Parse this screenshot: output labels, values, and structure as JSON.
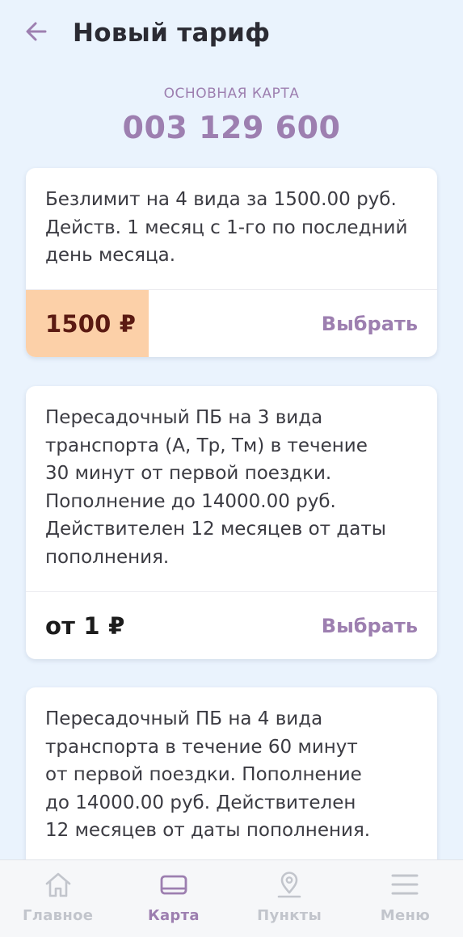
{
  "header": {
    "back_icon": "arrow-left-icon",
    "title": "Новый тариф"
  },
  "card": {
    "label": "ОСНОВНАЯ КАРТА",
    "number": "003 129 600"
  },
  "tariffs": [
    {
      "description": "Безлимит на 4 вида за 1500.00 руб. Действ. 1 месяц с 1-го по последний день месяца.",
      "price": "1500 ₽",
      "price_highlight_color": "#fcd0a8",
      "select_label": "Выбрать"
    },
    {
      "description": "Пересадочный ПБ на 3 вида транспорта (А, Тр, Тм) в течение 30 минут от первой поездки. Пополнение до 14000.00 руб. Действителен 12 месяцев от даты пополнения.",
      "price": "от 1 ₽",
      "select_label": "Выбрать"
    },
    {
      "description": "Пересадочный ПБ на 4 вида транспорта в течение 60 минут от первой поездки. Пополнение до 14000.00 руб. Действителен 12 месяцев от даты пополнения."
    }
  ],
  "bottom_nav": [
    {
      "label": "Главное",
      "icon": "home-icon",
      "active": false
    },
    {
      "label": "Карта",
      "icon": "wallet-icon",
      "active": true
    },
    {
      "label": "Пункты",
      "icon": "location-pin-icon",
      "active": false
    },
    {
      "label": "Меню",
      "icon": "menu-icon",
      "active": false
    }
  ],
  "colors": {
    "accent": "#9d7fb0",
    "background": "#eaf3fd",
    "nav_inactive": "#c2c5cc"
  }
}
